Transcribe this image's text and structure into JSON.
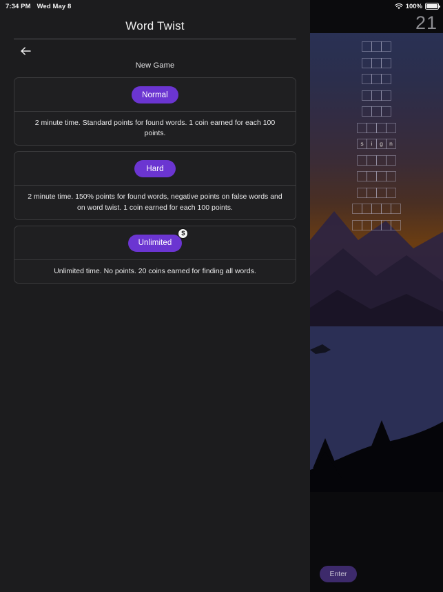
{
  "status_bar": {
    "time": "7:34 PM",
    "date": "Wed May 8",
    "battery_percent": "100%",
    "wifi_icon": "wifi-icon",
    "battery_icon": "battery-full-icon"
  },
  "sheet": {
    "title": "Word Twist",
    "back_icon": "arrow-left-icon",
    "section_label": "New Game",
    "modes": [
      {
        "id": "normal",
        "label": "Normal",
        "description": "2 minute time. Standard points for found words. 1 coin earned for each 100 points.",
        "has_coin_badge": false,
        "coin_badge_symbol": ""
      },
      {
        "id": "hard",
        "label": "Hard",
        "description": "2 minute time. 150% points for found words, negative points on false words and on word twist. 1 coin earned for each 100 points.",
        "has_coin_badge": false,
        "coin_badge_symbol": ""
      },
      {
        "id": "unlimited",
        "label": "Unlimited",
        "description": "Unlimited time. No points. 20 coins earned for finding all words.",
        "has_coin_badge": true,
        "coin_badge_symbol": "$"
      }
    ]
  },
  "game": {
    "score": "21",
    "enter_label": "Enter",
    "word_input_value": "",
    "word_slots": [
      {
        "length": 3,
        "letters": [
          "",
          "",
          ""
        ]
      },
      {
        "length": 3,
        "letters": [
          "",
          "",
          ""
        ]
      },
      {
        "length": 3,
        "letters": [
          "",
          "",
          ""
        ]
      },
      {
        "length": 3,
        "letters": [
          "",
          "",
          ""
        ]
      },
      {
        "length": 3,
        "letters": [
          "",
          "",
          ""
        ]
      },
      {
        "length": 4,
        "letters": [
          "",
          "",
          "",
          ""
        ]
      },
      {
        "length": 4,
        "letters": [
          "s",
          "i",
          "g",
          "n"
        ]
      },
      {
        "length": 4,
        "letters": [
          "",
          "",
          "",
          ""
        ]
      },
      {
        "length": 4,
        "letters": [
          "",
          "",
          "",
          ""
        ]
      },
      {
        "length": 4,
        "letters": [
          "",
          "",
          "",
          ""
        ]
      },
      {
        "length": 5,
        "letters": [
          "",
          "",
          "",
          "",
          ""
        ]
      },
      {
        "length": 5,
        "letters": [
          "",
          "",
          "",
          "",
          ""
        ]
      }
    ]
  },
  "colors": {
    "accent_purple": "#6b35d1",
    "enter_purple": "#3d2a6b",
    "sheet_bg": "#1c1c1e",
    "card_border": "#3a3a3c",
    "coin_badge": "#f7f7f7"
  }
}
